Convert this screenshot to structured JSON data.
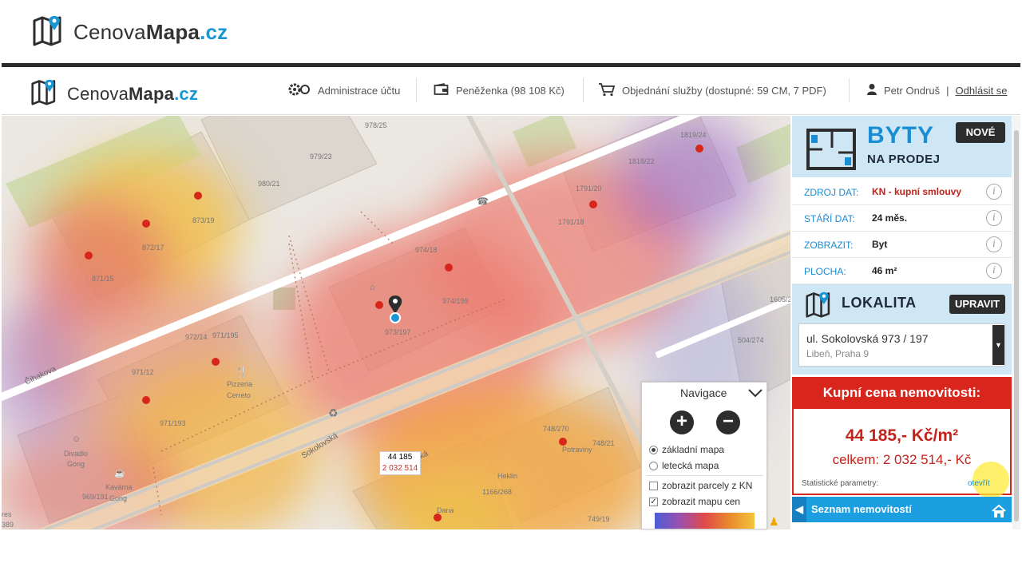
{
  "brand": {
    "logo_text_regular": "Cenova",
    "logo_text_bold": "Mapa",
    "logo_text_tld": ".cz"
  },
  "header": {
    "admin_label": "Administrace účtu",
    "wallet_label": "Peněženka (98 108 Kč)",
    "order_label": "Objednání služby (dostupné: 59 CM, 7 PDF)",
    "user_name": "Petr Ondruš",
    "user_sep": "|",
    "logout_label": "Odhlásit se"
  },
  "map": {
    "labels": {
      "p978_25": "978/25",
      "p979_23": "979/23",
      "p980_21": "980/21",
      "p873_19": "873/19",
      "p872_17": "872/17",
      "p871_15": "871/15",
      "p974_18": "974/18",
      "p974_199": "974/199",
      "p973_197": "973/197",
      "p972_14": "972/14",
      "p971_195": "971/195",
      "p971_12": "971/12",
      "p971_193": "971/193",
      "p1819_24": "1819/24",
      "p1818_22": "1818/22",
      "p1791_20": "1791/20",
      "p1791_18": "1791/18",
      "p1605_2": "1605/2",
      "p504_274": "504/274",
      "p748_270": "748/270",
      "p748_21": "748/21",
      "p1166_268": "1166/268",
      "p749_19": "749/19",
      "p969_191": "969/191",
      "street_cihakova": "Čihakova",
      "street_sokolovska1": "Sokolovská",
      "street_sokolovska2": "Sokolovská",
      "pizzeria": "Pizzeria",
      "cerreto": "Cerreto",
      "divadlo": "Divadlo",
      "gong1": "Gong",
      "kavarna": "Kavárna",
      "gong2": "Gong",
      "potraviny": "Potraviny",
      "heklin": "Heklin",
      "dana": "Dana",
      "edge_res": "res",
      "edge_389": "389"
    },
    "popup": {
      "price_m2": "44 185",
      "price_total": "2 032 514"
    }
  },
  "navigation": {
    "title": "Navigace",
    "zoom_in": "+",
    "zoom_out": "−",
    "basic_map": "základní mapa",
    "aerial_map": "letecká mapa",
    "show_parcels": "zobrazit parcely z KN",
    "show_price_map": "zobrazit mapu cen",
    "basic_map_selected": true,
    "show_parcels_checked": false,
    "show_price_map_checked": true
  },
  "panel": {
    "category_title": "BYTY",
    "category_subtitle": "NA PRODEJ",
    "new_button": "NOVÉ",
    "rows": [
      {
        "label": "ZDROJ DAT:",
        "value": "KN - kupní smlouvy",
        "value_color": "#c2231a"
      },
      {
        "label": "STÁŘÍ DAT:",
        "value": "24 měs.",
        "value_color": "#222222"
      },
      {
        "label": "ZOBRAZIT:",
        "value": "Byt",
        "value_color": "#222222"
      },
      {
        "label": "PLOCHA:",
        "value": "46 m²",
        "value_color": "#222222"
      }
    ],
    "info_icon": "i",
    "locality_title": "LOKALITA",
    "edit_button": "UPRAVIT",
    "address_line1": "ul. Sokolovská 973 / 197",
    "address_line2": "Libeň, Praha 9",
    "price_header": "Kupní cena nemovitosti:",
    "price_m2": "44 185,- Kč/m²",
    "price_total": "celkem: 2 032 514,- Kč",
    "stats_label": "Statistické parametry:",
    "stats_link": "otevřít",
    "list_label": "Seznam nemovitostí"
  },
  "colors": {
    "accent_blue": "#1a8dd4",
    "price_red": "#d9261c",
    "dark_button": "#2d2d2d",
    "panel_blue_bg": "#cfe6f5"
  }
}
